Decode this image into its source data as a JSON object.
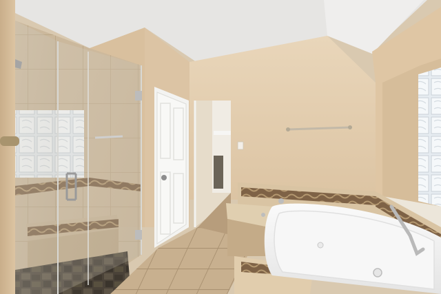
{
  "scene": {
    "subject": "bathroom-interior",
    "colors": {
      "wall": "#e3cfb3",
      "wall_shadow": "#d2bb9c",
      "ceiling": "#e8e7e6",
      "floor_tile": "#c9b292",
      "grout": "#a89272",
      "glass": "#cfd3cf",
      "door": "#f4f4f2",
      "tub": "#f3f3f3",
      "tile_border": "#8a6a48",
      "window_block": "#dfe6ec"
    }
  }
}
